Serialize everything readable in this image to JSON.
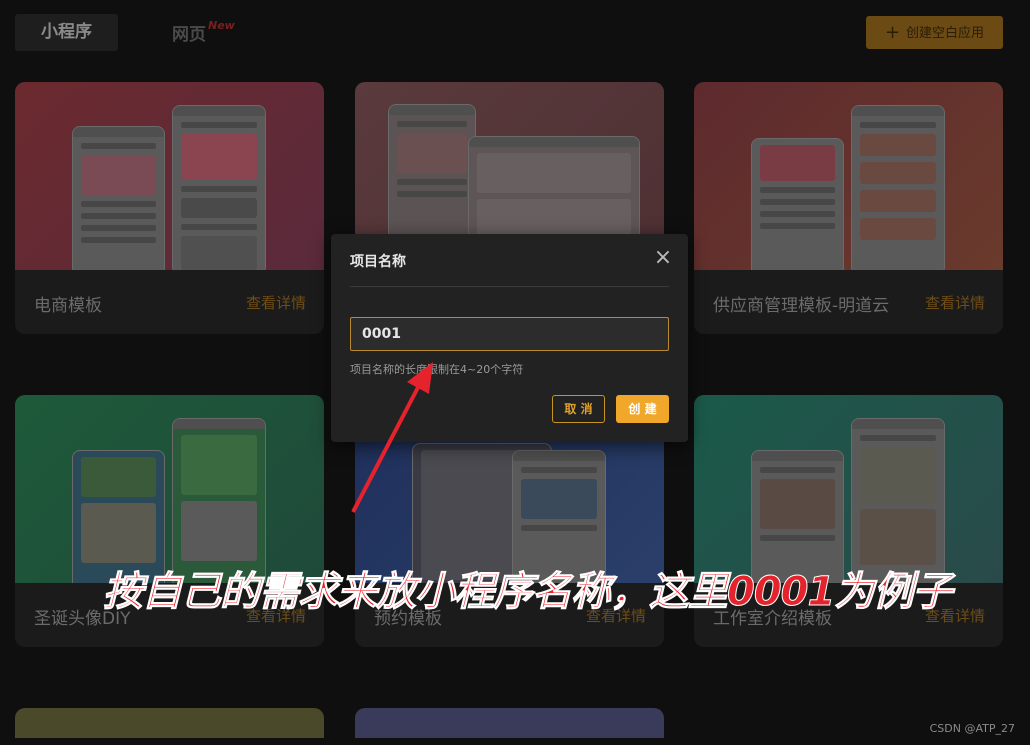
{
  "tabs": {
    "mini_program": "小程序",
    "web": "网页",
    "web_badge": "New"
  },
  "create_blank": {
    "icon": "plus-icon",
    "label": "创建空白应用"
  },
  "cards": [
    {
      "name": "电商模板",
      "detail": "查看详情"
    },
    {
      "name": "",
      "detail": ""
    },
    {
      "name": "供应商管理模板-明道云",
      "detail": "查看详情"
    },
    {
      "name": "圣诞头像DIY",
      "detail": "查看详情"
    },
    {
      "name": "预约模板",
      "detail": "查看详情"
    },
    {
      "name": "工作室介绍模板",
      "detail": "查看详情"
    }
  ],
  "modal": {
    "title": "项目名称",
    "input_value": "0001",
    "hint": "项目名称的长度限制在4~20个字符",
    "cancel": "取 消",
    "create": "创 建",
    "close_icon": "close-icon"
  },
  "annotation": "按自己的需求来放小程序名称，这里0001为例子",
  "watermark": "CSDN @ATP_27",
  "colors": {
    "accent": "#f0a72a",
    "annotation": "#e5232c"
  }
}
